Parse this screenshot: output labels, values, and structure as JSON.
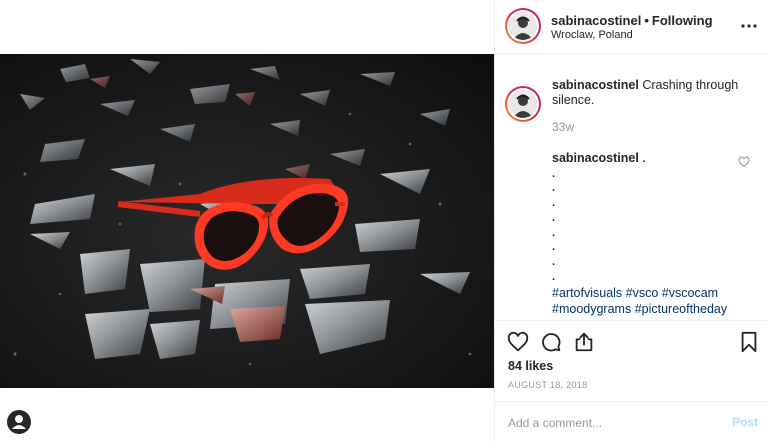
{
  "post": {
    "username": "sabinacostinel",
    "follow_status": "Following",
    "separator": "•",
    "location": "Wroclaw, Poland",
    "caption_text": "Crashing through silence.",
    "time_ago": "33w",
    "likes": "84 likes",
    "date": "AUGUST 18, 2018"
  },
  "comment": {
    "username": "sabinacostinel",
    "first_line": ".",
    "dots": [
      ".",
      ".",
      ".",
      ".",
      ".",
      ".",
      ".",
      "."
    ],
    "hashtags_line1": [
      "#artofvisuals",
      "#vsco",
      "#vscocam"
    ],
    "hashtags_line2": [
      "#moodygrams",
      "#pictureoftheday"
    ]
  },
  "composer": {
    "placeholder": "Add a comment...",
    "post_label": "Post"
  },
  "icons": {
    "more": "more-horizontal-icon",
    "like": "heart-icon",
    "comment": "speech-bubble-icon",
    "share": "share-icon",
    "save": "bookmark-icon",
    "comment_like": "small-heart-icon",
    "profile": "user-profile-icon"
  },
  "colors": {
    "link": "#003569",
    "muted": "#999999",
    "post_disabled": "#b2dffc",
    "glasses": "#ff3a24"
  }
}
